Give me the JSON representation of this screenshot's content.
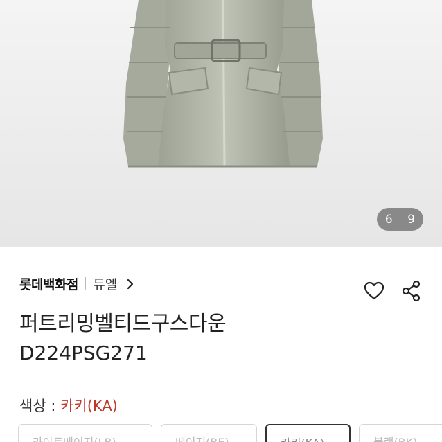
{
  "gallery": {
    "current": "6",
    "total": "9"
  },
  "seller": {
    "store": "롯데백화점",
    "brand": "듀엘"
  },
  "icons": {
    "wishlist": "heart-icon",
    "share": "share-icon",
    "brand_link": "chevron-right-icon"
  },
  "product": {
    "title": "퍼트리밍벨티드구스다운",
    "code": "D224PSG271"
  },
  "color": {
    "label": "색상 : ",
    "value": "카키(KA)",
    "value_color": "#c0392b"
  },
  "color_options": [
    {
      "label": "라이트베이지(LB)"
    },
    {
      "label": "베이지(BE)"
    },
    {
      "label": "카키(KA)"
    },
    {
      "label": "블랙(BK)"
    }
  ]
}
